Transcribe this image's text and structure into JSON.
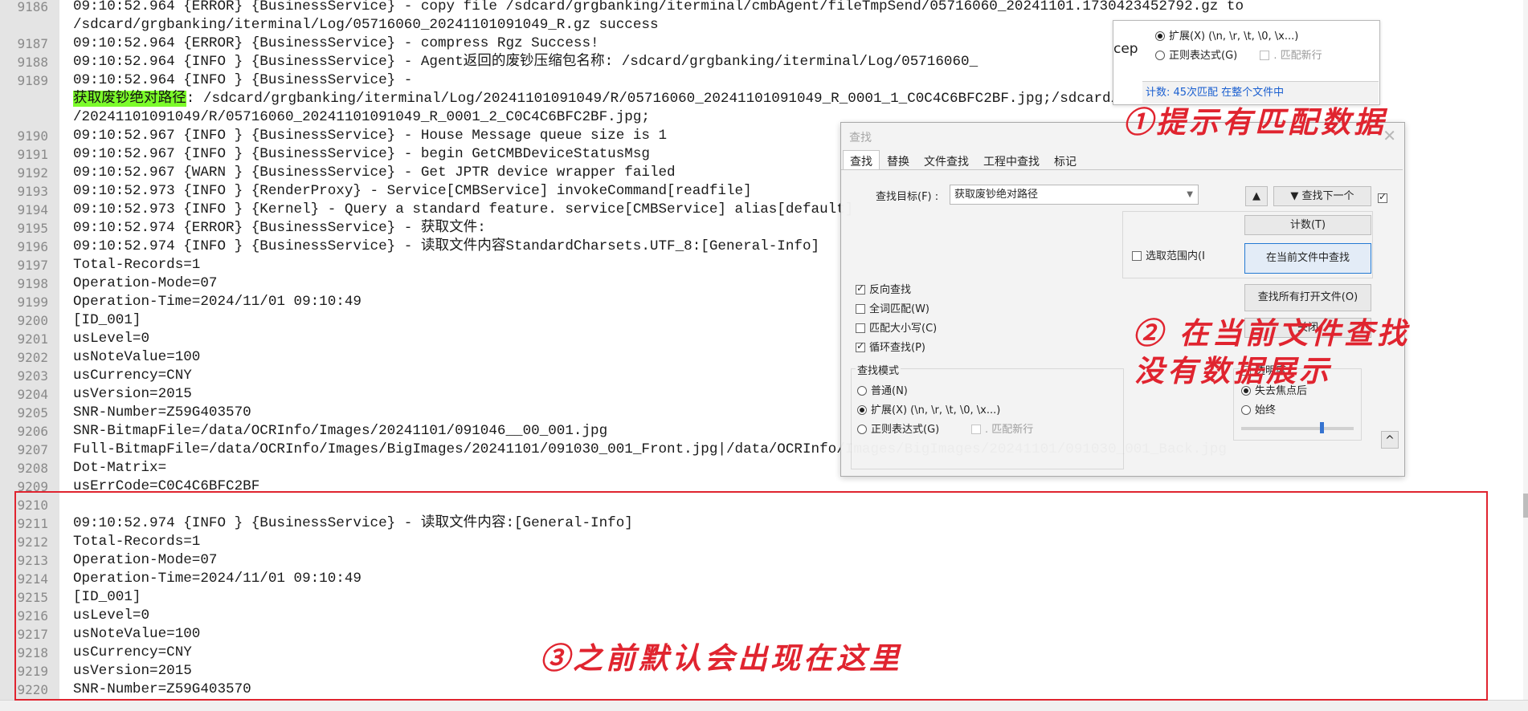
{
  "editor": {
    "lines": [
      {
        "num": "9186",
        "text": "09:10:52.964 {ERROR} {BusinessService} - copy file /sdcard/grgbanking/iterminal/cmbAgent/fileTmpSend/05716060_20241101.1730423452792.gz to"
      },
      {
        "num": "",
        "text": "/sdcard/grgbanking/iterminal/Log/05716060_20241101091049_R.gz success"
      },
      {
        "num": "9187",
        "text": "09:10:52.964 {ERROR} {BusinessService} - compress Rgz Success!"
      },
      {
        "num": "9188",
        "text": "09:10:52.964 {INFO } {BusinessService} - Agent返回的废钞压缩包名称: /sdcard/grgbanking/iterminal/Log/05716060_"
      },
      {
        "num": "9189",
        "text": "09:10:52.964 {INFO } {BusinessService} -"
      },
      {
        "num": "",
        "highlight": "获取废钞绝对路径",
        "text": ": /sdcard/grgbanking/iterminal/Log/20241101091049/R/05716060_20241101091049_R_0001_1_C0C4C6BFC2BF.jpg;/sdcard/grgbanking/iterminal/Log"
      },
      {
        "num": "",
        "text": "/20241101091049/R/05716060_20241101091049_R_0001_2_C0C4C6BFC2BF.jpg;"
      },
      {
        "num": "9190",
        "text": "09:10:52.967 {INFO } {BusinessService} - House Message queue size is 1"
      },
      {
        "num": "9191",
        "text": "09:10:52.967 {INFO } {BusinessService} - begin GetCMBDeviceStatusMsg"
      },
      {
        "num": "9192",
        "text": "09:10:52.967 {WARN } {BusinessService} - Get JPTR device wrapper failed"
      },
      {
        "num": "9193",
        "text": "09:10:52.973 {INFO } {RenderProxy} - Service[CMBService] invokeCommand[readfile]"
      },
      {
        "num": "9194",
        "text": "09:10:52.973 {INFO } {Kernel} - Query a standard feature. service[CMBService] alias[default]"
      },
      {
        "num": "9195",
        "text": "09:10:52.974 {ERROR} {BusinessService} - 获取文件:"
      },
      {
        "num": "9196",
        "text": "09:10:52.974 {INFO } {BusinessService} - 读取文件内容StandardCharsets.UTF_8:[General-Info]"
      },
      {
        "num": "9197",
        "text": "Total-Records=1"
      },
      {
        "num": "9198",
        "text": "Operation-Mode=07"
      },
      {
        "num": "9199",
        "text": "Operation-Time=2024/11/01 09:10:49"
      },
      {
        "num": "9200",
        "text": "[ID_001]"
      },
      {
        "num": "9201",
        "text": "usLevel=0"
      },
      {
        "num": "9202",
        "text": "usNoteValue=100"
      },
      {
        "num": "9203",
        "text": "usCurrency=CNY"
      },
      {
        "num": "9204",
        "text": "usVersion=2015"
      },
      {
        "num": "9205",
        "text": "SNR-Number=Z59G403570"
      },
      {
        "num": "9206",
        "text": "SNR-BitmapFile=/data/OCRInfo/Images/20241101/091046__00_001.jpg"
      },
      {
        "num": "9207",
        "text": "Full-BitmapFile=/data/OCRInfo/Images/BigImages/20241101/091030_001_Front.jpg|/data/OCRInfo/Images/BigImages/20241101/091030_001_Back.jpg"
      },
      {
        "num": "9208",
        "text": "Dot-Matrix="
      },
      {
        "num": "9209",
        "text": "usErrCode=C0C4C6BFC2BF"
      },
      {
        "num": "9210",
        "text": ""
      },
      {
        "num": "9211",
        "text": "09:10:52.974 {INFO } {BusinessService} - 读取文件内容:[General-Info]"
      },
      {
        "num": "9212",
        "text": "Total-Records=1"
      },
      {
        "num": "9213",
        "text": "Operation-Mode=07"
      },
      {
        "num": "9214",
        "text": "Operation-Time=2024/11/01 09:10:49"
      },
      {
        "num": "9215",
        "text": "[ID_001]"
      },
      {
        "num": "9216",
        "text": "usLevel=0"
      },
      {
        "num": "9217",
        "text": "usNoteValue=100"
      },
      {
        "num": "9218",
        "text": "usCurrency=CNY"
      },
      {
        "num": "9219",
        "text": "usVersion=2015"
      },
      {
        "num": "9220",
        "text": "SNR-Number=Z59G403570"
      }
    ]
  },
  "mini_panel": {
    "cut_text": "cep",
    "extended_label": "扩展(X) (\\n, \\r, \\t, \\0, \\x...)",
    "regex_label": "正则表达式(G)",
    "newline_label": ". 匹配新行",
    "status": "计数: 45次匹配 在整个文件中"
  },
  "dialog": {
    "title": "查找",
    "close_glyph": "✕",
    "tabs": [
      "查找",
      "替换",
      "文件查找",
      "工程中查找",
      "标记"
    ],
    "target_label": "查找目标(F) :",
    "target_value": "获取废钞绝对路径",
    "prev_glyph": "▲",
    "next_label": "▼ 查找下一个",
    "count_label": "计数(T)",
    "in_selection_label": "选取范围内(I",
    "find_in_current_label": "在当前文件中查找",
    "find_all_open_label": "查找所有打开文件(O)",
    "close_label": "关闭",
    "reverse_label": "反向查找",
    "whole_word_label": "全词匹配(W)",
    "match_case_label": "匹配大小写(C)",
    "wrap_label": "循环查找(P)",
    "mode_title": "查找模式",
    "mode_normal": "普通(N)",
    "mode_extended": "扩展(X) (\\n, \\r, \\t, \\0, \\x...)",
    "mode_regex": "正则表达式(G)",
    "mode_newline": ". 匹配新行",
    "transparency_title": "透明度",
    "on_lose_focus": "失去焦点后",
    "always": "始终",
    "collapse_glyph": "^"
  },
  "annotations": {
    "a1": "①提示有匹配数据",
    "a2_line1": "② 在当前文件查找",
    "a2_line2": "没有数据展示",
    "a3": "③之前默认会出现在这里"
  },
  "colors": {
    "annotation_red": "#e0242f",
    "highlight_green": "#7CFC2A",
    "status_blue": "#1a5fd0"
  }
}
